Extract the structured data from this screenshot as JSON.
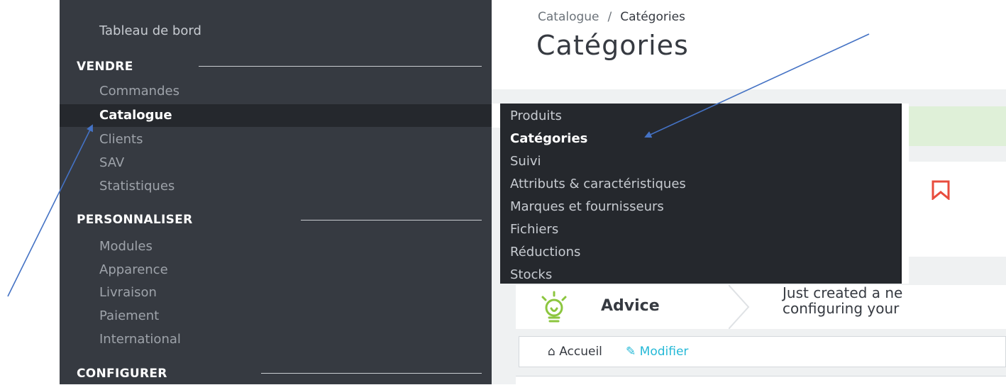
{
  "sidebar": {
    "dashboard": "Tableau de bord",
    "sections": [
      {
        "title": "VENDRE",
        "items": [
          "Commandes",
          "Catalogue",
          "Clients",
          "SAV",
          "Statistiques"
        ]
      },
      {
        "title": "PERSONNALISER",
        "items": [
          "Modules",
          "Apparence",
          "Livraison",
          "Paiement",
          "International"
        ]
      },
      {
        "title": "CONFIGURER",
        "items": []
      }
    ]
  },
  "submenu": {
    "items": [
      "Produits",
      "Catégories",
      "Suivi",
      "Attributs & caractéristiques",
      "Marques et fournisseurs",
      "Fichiers",
      "Réductions",
      "Stocks"
    ],
    "active": "Catégories"
  },
  "header": {
    "breadcrumb": [
      "Catalogue",
      "Catégories"
    ],
    "breadcrumb_sep": "/",
    "title": "Catégories"
  },
  "advice": {
    "label": "Advice",
    "text_line1": "Just created a ne",
    "text_line2": "configuring your"
  },
  "toolbar": {
    "home_label": "Accueil",
    "edit_label": "Modifier"
  },
  "colors": {
    "sidebar": "#363a41",
    "submenu": "#25282d",
    "accent": "#25b9d7",
    "annotation_arrow": "#4472c4"
  }
}
